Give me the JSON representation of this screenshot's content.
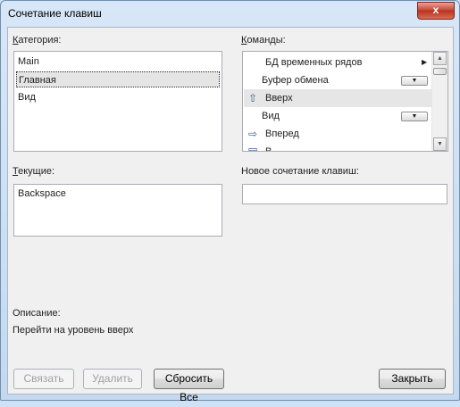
{
  "window": {
    "title": "Сочетание клавиш",
    "close_glyph": "x"
  },
  "category": {
    "label_underlined": "К",
    "label_rest": "атегория:",
    "items": [
      "Main",
      "Главная",
      "Вид"
    ],
    "selected_index": 1
  },
  "commands": {
    "label_underlined": "К",
    "label_rest": "оманды:",
    "items": [
      {
        "label": "БД временных рядов",
        "icon": "",
        "control": "submenu-arrow"
      },
      {
        "label": "Буфер обмена",
        "icon": "",
        "control": "dropdown"
      },
      {
        "label": "Вверх",
        "icon": "arrow-up-icon",
        "control": ""
      },
      {
        "label": "Вид",
        "icon": "",
        "control": "dropdown"
      },
      {
        "label": "Вперед",
        "icon": "arrow-right-icon",
        "control": ""
      },
      {
        "label": "В...",
        "icon": "print-icon",
        "control": ""
      }
    ],
    "selected_index": 2
  },
  "current": {
    "label_underlined": "Т",
    "label_rest": "екущие:",
    "items": [
      "Backspace"
    ]
  },
  "new_shortcut": {
    "label": "Новое сочетание клавиш:",
    "value": ""
  },
  "description": {
    "label": "Описание:",
    "text": "Перейти на уровень вверх"
  },
  "buttons": {
    "assign": "Связать",
    "remove": "Удалить",
    "reset_all": "Сбросить Все",
    "close": "Закрыть"
  },
  "colors": {
    "selection": "#e5e5e5",
    "close_button": "#c9493a"
  }
}
